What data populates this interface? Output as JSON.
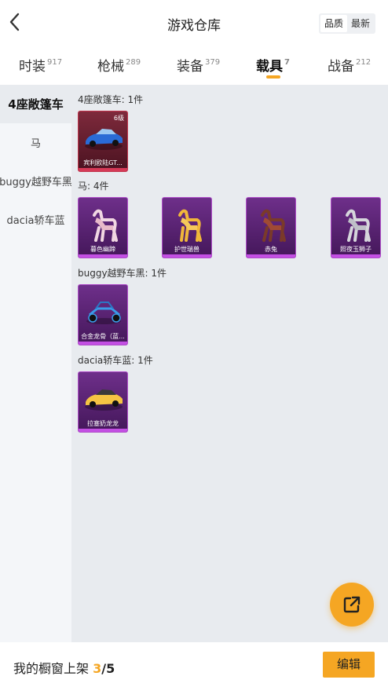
{
  "header": {
    "title": "游戏仓库",
    "sort_options": [
      "品质",
      "最新"
    ],
    "active_sort": "品质"
  },
  "tabs": [
    {
      "label": "时装",
      "count": "917"
    },
    {
      "label": "枪械",
      "count": "289"
    },
    {
      "label": "装备",
      "count": "379"
    },
    {
      "label": "载具",
      "count": "7"
    },
    {
      "label": "战备",
      "count": "212"
    }
  ],
  "sidebar": {
    "items": [
      {
        "label": "4座敞篷车"
      },
      {
        "label": "马"
      },
      {
        "label": "buggy越野车黑"
      },
      {
        "label": "dacia轿车蓝"
      }
    ]
  },
  "sections": [
    {
      "title": "4座敞篷车: 1件",
      "items": [
        {
          "name": "宾利欧陆GT...",
          "level": "6级",
          "rarity": "red"
        }
      ]
    },
    {
      "title": "马: 4件",
      "items": [
        {
          "name": "暮色幽蹄",
          "rarity": "purple"
        },
        {
          "name": "护世瑞兽",
          "rarity": "purple"
        },
        {
          "name": "赤兔",
          "rarity": "purple"
        },
        {
          "name": "照夜玉狮子",
          "rarity": "purple"
        }
      ]
    },
    {
      "title": "buggy越野车黑: 1件",
      "items": [
        {
          "name": "合金龙骨（蓝...",
          "rarity": "purple"
        }
      ]
    },
    {
      "title": "dacia轿车蓝: 1件",
      "items": [
        {
          "name": "拉塞奶龙龙",
          "rarity": "purple"
        }
      ]
    }
  ],
  "footer": {
    "label": "我的橱窗上架",
    "current": "3",
    "separator": "/",
    "total": "5",
    "edit_label": "编辑"
  },
  "colors": {
    "accent": "#f5a623",
    "red_rarity": "#d63a57",
    "purple_rarity": "#c34fe3"
  },
  "icons": {
    "back": "chevron-left-icon",
    "share": "share-icon"
  }
}
